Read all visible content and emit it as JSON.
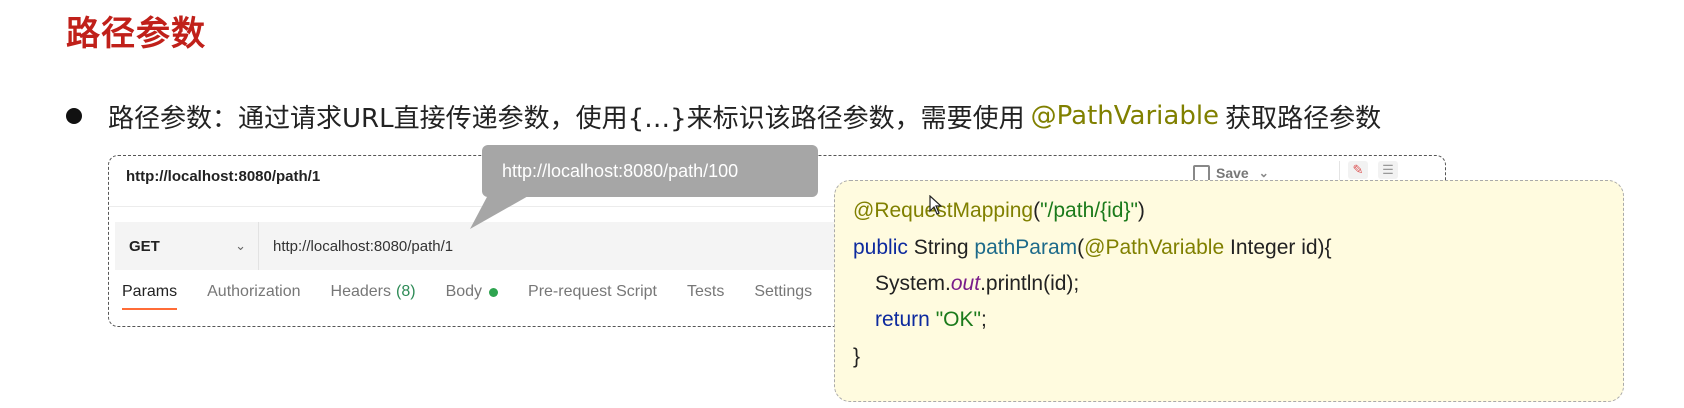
{
  "slide": {
    "title": "路径参数",
    "bullet": {
      "text_before": "路径参数：通过请求URL直接传递参数，使用{…}来标识该路径参数，需要使用",
      "highlight": "@PathVariable",
      "text_after": "获取路径参数"
    }
  },
  "postman": {
    "request_name": "http://localhost:8080/path/1",
    "save_label": "Save",
    "method": "GET",
    "url": "http://localhost:8080/path/1",
    "tabs": [
      {
        "label": "Params"
      },
      {
        "label": "Authorization"
      },
      {
        "label": "Headers",
        "count": "(8)"
      },
      {
        "label": "Body"
      },
      {
        "label": "Pre-request Script"
      },
      {
        "label": "Tests"
      },
      {
        "label": "Settings"
      }
    ]
  },
  "callout": {
    "text": "http://localhost:8080/path/100"
  },
  "code": {
    "line1": {
      "annotation": "@RequestMapping",
      "open": "(",
      "string": "\"/path/{id}\"",
      "close": ")"
    },
    "line2": {
      "kw": "public",
      "type": " String ",
      "method": "pathParam",
      "open": "(",
      "annotation": "@PathVariable",
      "rest": " Integer id){"
    },
    "line3": {
      "start": "System.",
      "field": "out",
      "rest": ".println(id);"
    },
    "line4": {
      "kw": "return",
      "string": " \"OK\"",
      "rest": ";"
    },
    "line5": {
      "text": "}"
    }
  },
  "colors": {
    "title": "#c0201a",
    "annotation": "#808000",
    "callout_bg": "#a6a6a6",
    "code_bg": "#fffbdf",
    "tab_active": "#ff6c37"
  }
}
